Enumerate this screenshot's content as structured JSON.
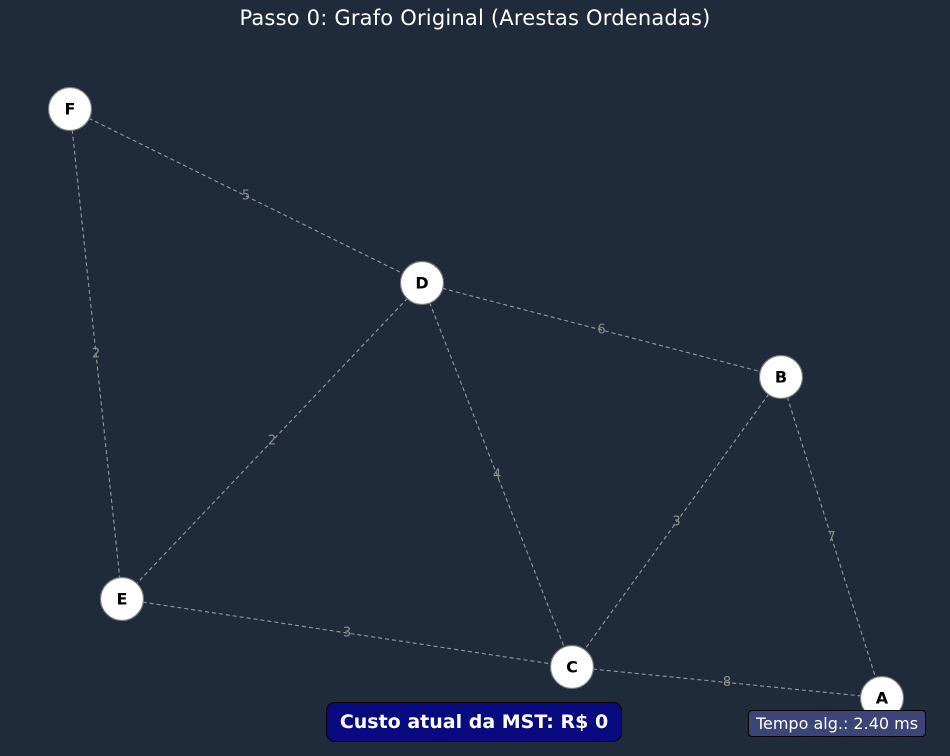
{
  "title": "Passo 0: Grafo Original (Arestas Ordenadas)",
  "nodes": [
    {
      "id": "F",
      "label": "F"
    },
    {
      "id": "D",
      "label": "D"
    },
    {
      "id": "B",
      "label": "B"
    },
    {
      "id": "E",
      "label": "E"
    },
    {
      "id": "C",
      "label": "C"
    },
    {
      "id": "A",
      "label": "A"
    }
  ],
  "edges": [
    {
      "from": "F",
      "to": "D",
      "weight": "5"
    },
    {
      "from": "F",
      "to": "E",
      "weight": "2"
    },
    {
      "from": "D",
      "to": "B",
      "weight": "6"
    },
    {
      "from": "D",
      "to": "E",
      "weight": "2"
    },
    {
      "from": "D",
      "to": "C",
      "weight": "4"
    },
    {
      "from": "B",
      "to": "C",
      "weight": "3"
    },
    {
      "from": "B",
      "to": "A",
      "weight": "7"
    },
    {
      "from": "E",
      "to": "C",
      "weight": "3"
    },
    {
      "from": "C",
      "to": "A",
      "weight": "8"
    }
  ],
  "cost_label": "Custo atual da MST: R$ 0",
  "time_label": "Tempo alg.: 2.40 ms",
  "colors": {
    "background": "#1f2a3a",
    "edge": "#9a9a9a",
    "node_fill": "#ffffff",
    "cost_box": "#0a0a80",
    "time_box": "#3c4478"
  }
}
